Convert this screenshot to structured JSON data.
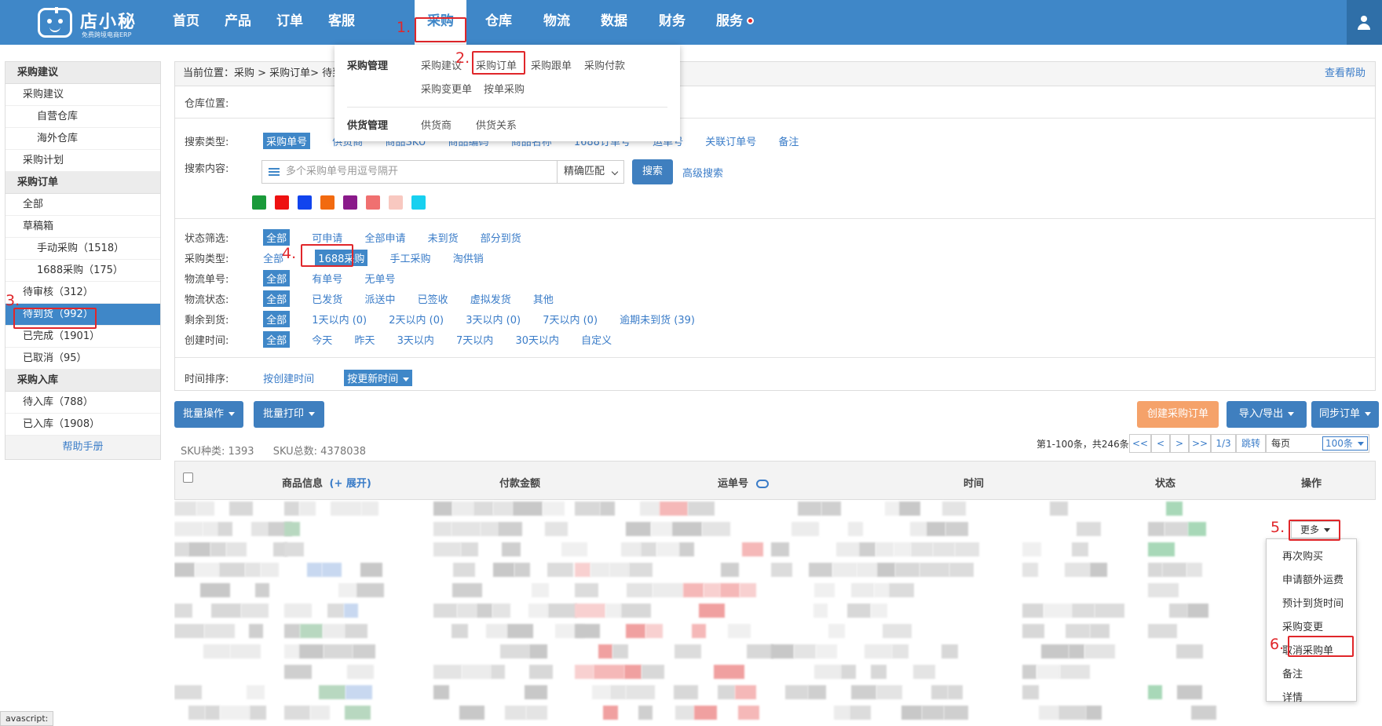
{
  "logo": {
    "name": "店小秘",
    "tagline": "免费跨境电商ERP"
  },
  "nav": {
    "items": [
      "首页",
      "产品",
      "订单",
      "客服",
      "采购",
      "仓库",
      "物流",
      "数据",
      "财务",
      "服务"
    ]
  },
  "dropdown": {
    "group1": "采购管理",
    "group1_links": [
      "采购建议",
      "采购订单",
      "采购跟单",
      "采购付款",
      "采购变更单",
      "按单采购"
    ],
    "group2": "供货管理",
    "group2_links": [
      "供货商",
      "供货关系"
    ]
  },
  "sidebar": {
    "sections": [
      {
        "title": "采购建议",
        "items": [
          {
            "label": "采购建议",
            "sub": false
          },
          {
            "label": "自营仓库",
            "sub": true
          },
          {
            "label": "海外仓库",
            "sub": true
          },
          {
            "label": "采购计划",
            "sub": false
          }
        ]
      },
      {
        "title": "采购订单",
        "items": [
          {
            "label": "全部",
            "sub": false
          },
          {
            "label": "草稿箱",
            "sub": false
          },
          {
            "label": "手动采购（1518）",
            "sub": true
          },
          {
            "label": "1688采购（175）",
            "sub": true
          },
          {
            "label": "待审核（312）",
            "sub": false
          },
          {
            "label": "待到货（992）",
            "sub": false,
            "selected": true
          },
          {
            "label": "已完成（1901）",
            "sub": false
          },
          {
            "label": "已取消（95）",
            "sub": false
          }
        ]
      },
      {
        "title": "采购入库",
        "items": [
          {
            "label": "待入库（788）",
            "sub": false
          },
          {
            "label": "已入库（1908）",
            "sub": false
          }
        ]
      }
    ],
    "help": "帮助手册"
  },
  "breadcrumb": {
    "text": "当前位置：采购 > 采购订单> 待到货",
    "help": "查看帮助"
  },
  "filters": {
    "warehouse_label": "仓库位置:",
    "search_type_label": "搜索类型:",
    "search_types": [
      "采购单号",
      "供货商",
      "商品SKU",
      "商品编码",
      "商品名称",
      "1688订单号",
      "运单号",
      "关联订单号",
      "备注"
    ],
    "search_content_label": "搜索内容:",
    "search_placeholder": "多个采购单号用逗号隔开",
    "match_mode": "精确匹配",
    "search_button": "搜索",
    "advanced_search": "高级搜索",
    "tag_colors": [
      "#1a9a3a",
      "#ee1111",
      "#1144ee",
      "#f26a10",
      "#8a1a8a",
      "#f07070",
      "#f8c8c0",
      "#18d0f0"
    ],
    "rows": [
      {
        "label": "状态筛选:",
        "options": [
          "全部",
          "可申请",
          "全部申请",
          "未到货",
          "部分到货"
        ]
      },
      {
        "label": "采购类型:",
        "options": [
          "全部",
          "1688采购",
          "手工采购",
          "淘供销"
        ]
      },
      {
        "label": "物流单号:",
        "options": [
          "全部",
          "有单号",
          "无单号"
        ]
      },
      {
        "label": "物流状态:",
        "options": [
          "全部",
          "已发货",
          "派送中",
          "已签收",
          "虚拟发货",
          "其他"
        ]
      },
      {
        "label": "剩余到货:",
        "options": [
          "全部",
          "1天以内 (0)",
          "2天以内 (0)",
          "3天以内 (0)",
          "7天以内 (0)",
          "逾期未到货 (39)"
        ]
      },
      {
        "label": "创建时间:",
        "options": [
          "全部",
          "今天",
          "昨天",
          "3天以内",
          "7天以内",
          "30天以内",
          "自定义"
        ]
      }
    ],
    "sort_label": "时间排序:",
    "sort_options": [
      "按创建时间",
      "按更新时间"
    ]
  },
  "toolbar": {
    "batch_ops": "批量操作",
    "batch_print": "批量打印",
    "create_order": "创建采购订单",
    "import_export": "导入/导出",
    "sync_orders": "同步订单"
  },
  "stats": {
    "sku_types": "SKU种类: 1393",
    "sku_total": "SKU总数: 4378038"
  },
  "pager": {
    "info": "第1-100条，共246条",
    "first": "<<",
    "prev": "<",
    "next": ">",
    "last": ">>",
    "page": "1/3",
    "jump": "跳转",
    "per_page_label": "每页",
    "per_page": "100条"
  },
  "table": {
    "headers": {
      "product": "商品信息",
      "expand": "(+ 展开)",
      "amount": "付款金额",
      "tracking": "运单号",
      "time": "时间",
      "status": "状态",
      "actions": "操作"
    }
  },
  "row_actions": {
    "more": "更多",
    "menu": [
      "再次购买",
      "申请额外运费",
      "预计到货时间",
      "采购变更",
      "取消采购单",
      "备注",
      "详情"
    ]
  },
  "steps": [
    "1.",
    "2.",
    "3.",
    "4.",
    "5.",
    "6."
  ],
  "status_bar": "avascript:"
}
